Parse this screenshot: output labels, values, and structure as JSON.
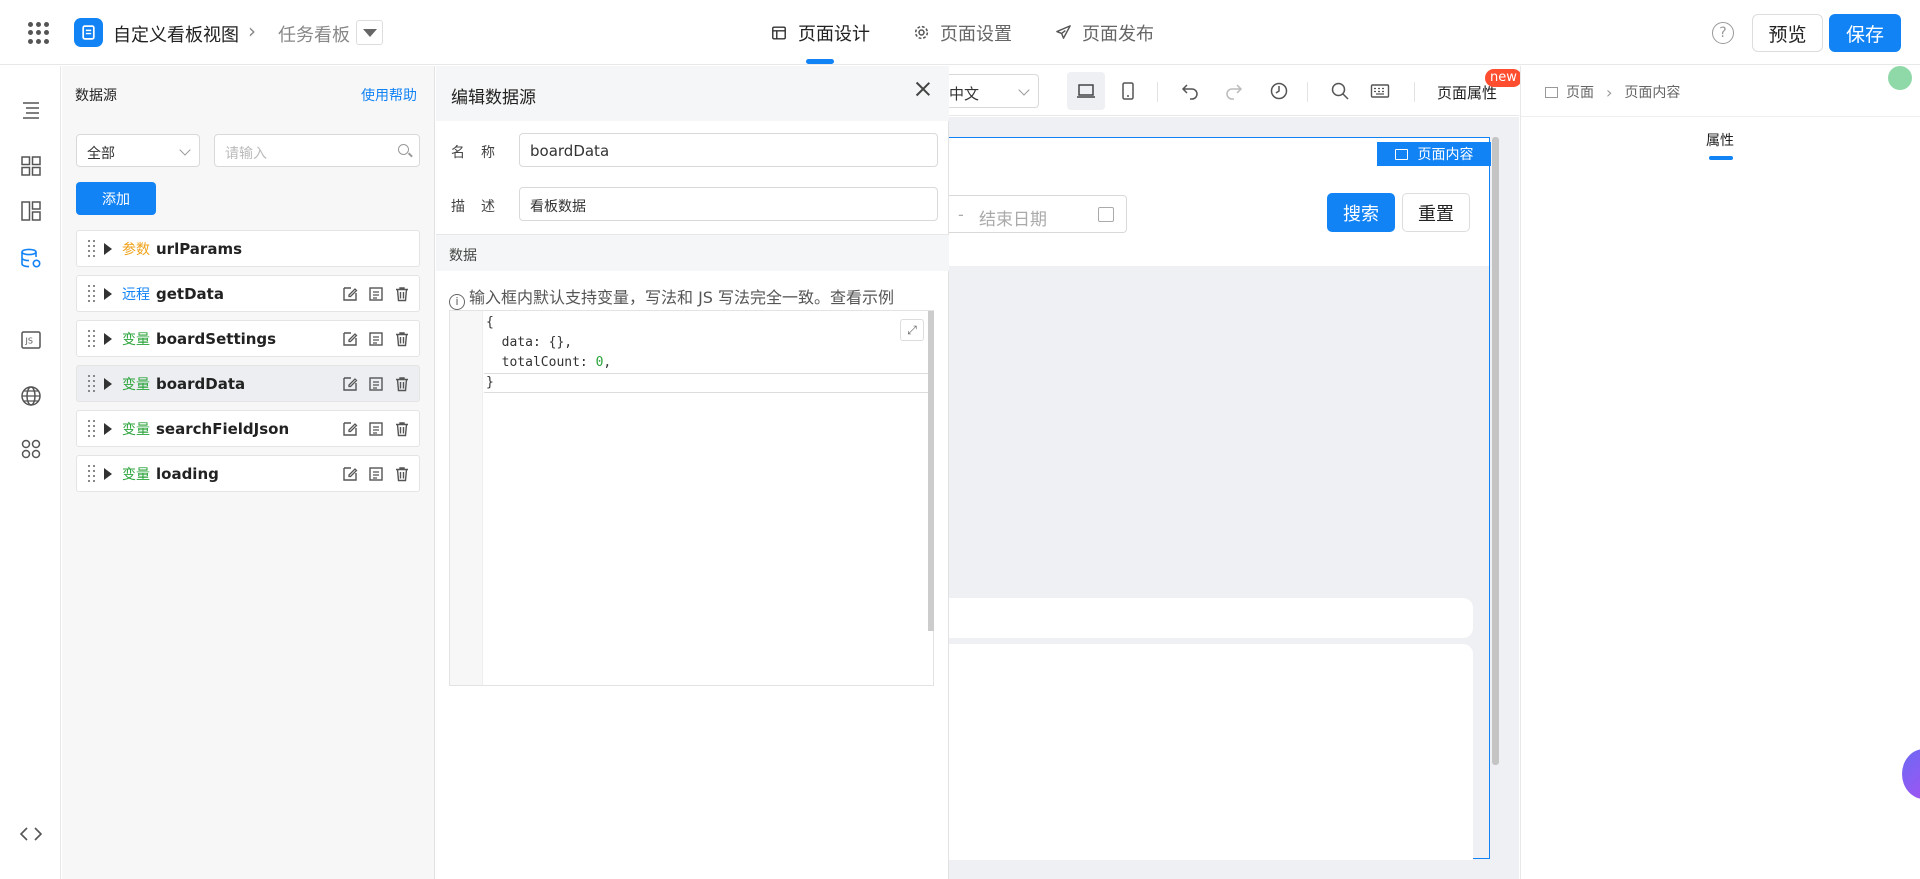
{
  "header": {
    "app_title": "自定义看板视图",
    "breadcrumb_sep": "›",
    "current_page": "任务看板",
    "tabs": [
      {
        "label": "页面设计",
        "icon": "layout-icon",
        "active": true
      },
      {
        "label": "页面设置",
        "icon": "gear-icon",
        "active": false
      },
      {
        "label": "页面发布",
        "icon": "send-icon",
        "active": false
      }
    ],
    "help_glyph": "?",
    "preview_label": "预览",
    "save_label": "保存",
    "accent_color": "#1283f5"
  },
  "datasource_panel": {
    "title": "数据源",
    "help_link": "使用帮助",
    "filter_value": "全部",
    "search_placeholder": "请输入",
    "add_label": "添加",
    "items": [
      {
        "tag": "参数",
        "tag_type": "param",
        "name": "urlParams",
        "has_actions": false,
        "selected": false
      },
      {
        "tag": "远程",
        "tag_type": "remote",
        "name": "getData",
        "has_actions": true,
        "selected": false
      },
      {
        "tag": "变量",
        "tag_type": "var",
        "name": "boardSettings",
        "has_actions": true,
        "selected": false
      },
      {
        "tag": "变量",
        "tag_type": "var",
        "name": "boardData",
        "has_actions": true,
        "selected": true
      },
      {
        "tag": "变量",
        "tag_type": "var",
        "name": "searchFieldJson",
        "has_actions": true,
        "selected": false
      },
      {
        "tag": "变量",
        "tag_type": "var",
        "name": "loading",
        "has_actions": true,
        "selected": false
      }
    ]
  },
  "edit_panel": {
    "title": "编辑数据源",
    "name_label": "名称",
    "name_value": "boardData",
    "desc_label": "描述",
    "desc_value": "看板数据",
    "data_label": "数据",
    "hint": "输入框内默认支持变量，写法和 JS 写法完全一致。查看示例",
    "code_lines": [
      "{",
      "  data: {},",
      "  totalCount: 0,",
      "}"
    ],
    "code_number": "0"
  },
  "canvas_toolbar": {
    "language_value": "中文",
    "page_prop_label": "页面属性",
    "new_badge": "new"
  },
  "canvas": {
    "frame_label": "页面内容",
    "date_separator": "-",
    "end_date_placeholder": "结束日期",
    "search_label": "搜索",
    "reset_label": "重置"
  },
  "right_panel": {
    "crumb_root": "页面",
    "crumb_current": "页面内容",
    "tab_label": "属性"
  }
}
